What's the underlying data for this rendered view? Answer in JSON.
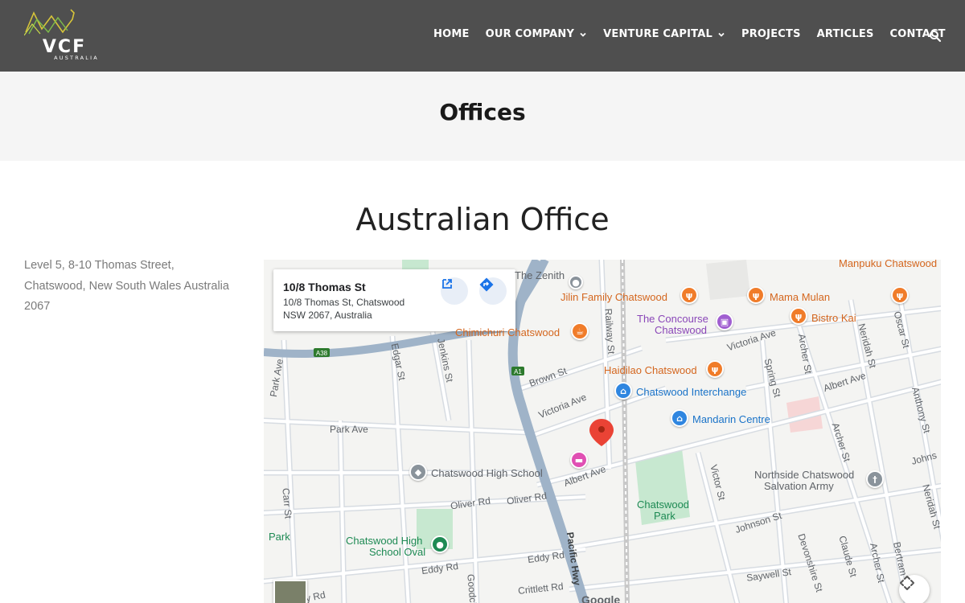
{
  "header": {
    "logo_text": "VCF",
    "logo_subtext": "AUSTRALIA",
    "nav": [
      {
        "label": "HOME",
        "has_dropdown": false
      },
      {
        "label": "OUR COMPANY",
        "has_dropdown": true
      },
      {
        "label": "VENTURE CAPITAL",
        "has_dropdown": true
      },
      {
        "label": "PROJECTS",
        "has_dropdown": false
      },
      {
        "label": "ARTICLES",
        "has_dropdown": false
      },
      {
        "label": "CONTACT",
        "has_dropdown": false
      }
    ],
    "search_icon": "search-icon"
  },
  "banner": {
    "title": "Offices"
  },
  "section": {
    "title": "Australian Office",
    "address_line1": "Level 5, 8-10 Thomas Street,",
    "address_line2": "Chatswood, New South Wales Australia",
    "address_line3": "2067"
  },
  "map": {
    "card": {
      "title": "10/8 Thomas St",
      "line1": "10/8 Thomas St, Chatswood",
      "line2": "NSW 2067, Australia",
      "open_icon": "open-in-new-icon",
      "directions_icon": "directions-icon"
    },
    "places": {
      "the_zenith": "The Zenith",
      "jilin": "Jilin Family Chatswood",
      "mama_mulan": "Mama Mulan",
      "manpuku": "Manpuku Chatswood",
      "concourse_1": "The Concourse",
      "concourse_2": "Chatswood",
      "bistro_kai": "Bistro Kai",
      "chimichurri": "Chimichuri Chatswood",
      "haidilao": "Haidilao Chatswood",
      "interchange": "Chatswood Interchange",
      "mandarin": "Mandarin Centre",
      "high_school": "Chatswood High School",
      "northside_1": "Northside Chatswood",
      "northside_2": "Salvation Army",
      "park_1": "Chatswood",
      "park_2": "Park",
      "oval_1": "Chatswood High",
      "oval_2": "School Oval",
      "park_left": "Park"
    },
    "streets": {
      "park_ave": "Park Ave",
      "park_ave2": "Park Ave",
      "edgar": "Edgar St",
      "jenkins": "Jenkins St",
      "railway": "Railway St",
      "brown": "Brown St",
      "victoria_ave": "Victoria Ave",
      "victoria_ave2": "Victoria Ave",
      "albert_ave": "Albert Ave",
      "albert_ave2": "Albert Ave",
      "spring": "Spring St",
      "archer": "Archer St",
      "archer2": "Archer St",
      "archer3": "Archer St",
      "neridah": "Neridah St",
      "neridah2": "Neridah St",
      "oscar": "Oscar St",
      "anthony": "Anthony St",
      "johns": "Johns",
      "victor": "Victor St",
      "johnson": "Johnson St",
      "oliver": "Oliver Rd",
      "oliver2": "Oliver Rd",
      "carr": "Carr St",
      "eddy": "Eddy Rd",
      "eddy2": "Eddy Rd",
      "pacific": "Pacific Hwy",
      "goodch": "Goodch",
      "crittlett": "Crittlett Rd",
      "devonshire": "Devonshire St",
      "claude": "Claude St",
      "saywell": "Saywell St",
      "bertram": "Bertram",
      "y_rd": "y Rd",
      "a38": "A38",
      "a1": "A1"
    },
    "google": "Google",
    "fullscreen_icon": "fullscreen-icon",
    "colors": {
      "road_major": "#9fb3c8",
      "road_minor": "#ffffff",
      "park": "#c7e8d0",
      "pin_red": "#ea4335",
      "orange": "#f07c2a",
      "purple": "#a05ed0",
      "blue": "#2f86e0",
      "green": "#1e8a54",
      "pink": "#e04fb3",
      "gray_pin": "#8a939b"
    }
  }
}
